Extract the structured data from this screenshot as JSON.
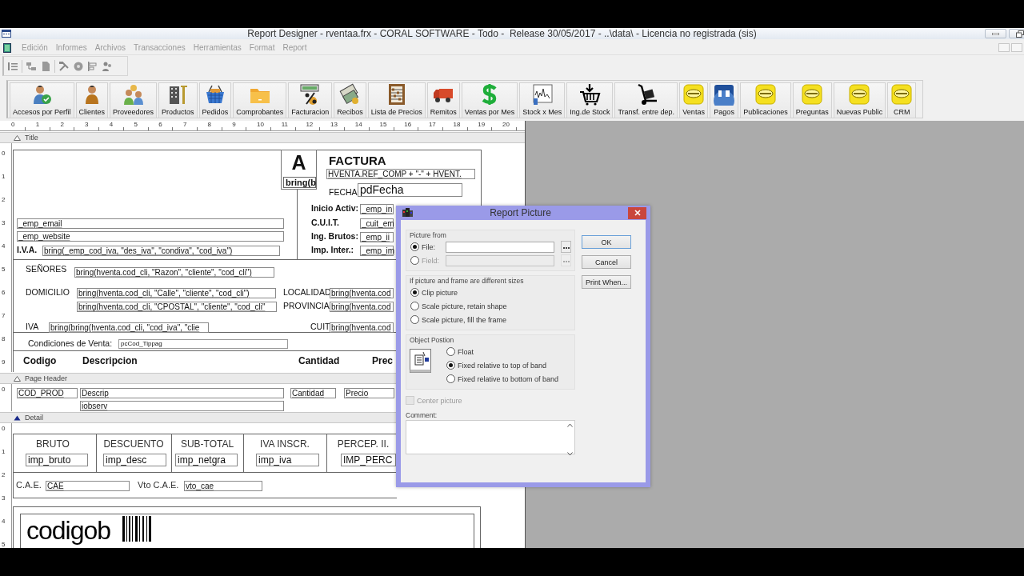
{
  "window": {
    "title": "Report Designer - rventaa.frx - CORAL SOFTWARE - Todo -  Release 30/05/2017 - ..\\data\\ - Licencia no registrada (sis)"
  },
  "menu": [
    {
      "label": "Edición",
      "disabled": true
    },
    {
      "label": "Informes",
      "disabled": true
    },
    {
      "label": "Archivos",
      "disabled": true
    },
    {
      "label": "Transacciones",
      "disabled": true
    },
    {
      "label": "Herramientas",
      "disabled": true
    },
    {
      "label": "Format",
      "disabled": true
    },
    {
      "label": "Report",
      "disabled": true
    }
  ],
  "toolbar": [
    {
      "label": "Accesos por Perfil"
    },
    {
      "label": "Clientes"
    },
    {
      "label": "Proveedores"
    },
    {
      "label": "Productos"
    },
    {
      "label": "Pedidos"
    },
    {
      "label": "Comprobantes"
    },
    {
      "label": "Facturacion"
    },
    {
      "label": "Recibos"
    },
    {
      "label": "Lista de Precios"
    },
    {
      "label": "Remitos"
    },
    {
      "label": "Ventas por Mes"
    },
    {
      "label": "Stock x Mes"
    },
    {
      "label": "Ing.de Stock"
    },
    {
      "label": "Transf. entre dep."
    },
    {
      "label": "Ventas"
    },
    {
      "label": "Pagos"
    },
    {
      "label": "Publicaciones"
    },
    {
      "label": "Preguntas"
    },
    {
      "label": "Nuevas Public"
    },
    {
      "label": "CRM"
    }
  ],
  "ruler": [
    "0",
    "1",
    "2",
    "3",
    "4",
    "5",
    "6",
    "7",
    "8",
    "9",
    "10",
    "11",
    "12",
    "13",
    "14",
    "15",
    "16",
    "17",
    "18",
    "19",
    "20"
  ],
  "bands": [
    {
      "label": "Title",
      "selected": false,
      "ruler": [
        "0",
        "1",
        "2",
        "3",
        "4",
        "5",
        "6",
        "7",
        "8",
        "9"
      ],
      "items": [
        {
          "kind": "letter",
          "text": "A"
        },
        {
          "kind": "bold-field",
          "text": "bring(b"
        },
        {
          "kind": "heading",
          "text": "FACTURA"
        },
        {
          "kind": "field",
          "text": "HVENTA.REF_COMP + \"-\"  + HVENT."
        },
        {
          "kind": "label",
          "text": "FECHA"
        },
        {
          "kind": "large-field",
          "text": "pdFecha"
        },
        {
          "kind": "bold-label",
          "text": "Inicio Activ:"
        },
        {
          "kind": "bold-label",
          "text": "C.U.I.T."
        },
        {
          "kind": "bold-label",
          "text": "Ing. Brutos:"
        },
        {
          "kind": "bold-label",
          "text": "Imp. Inter.:"
        },
        {
          "kind": "field",
          "text": "_emp_in"
        },
        {
          "kind": "field",
          "text": "_cuit_em"
        },
        {
          "kind": "field",
          "text": "_emp_ii"
        },
        {
          "kind": "field",
          "text": "_emp_im"
        },
        {
          "kind": "field",
          "text": "_emp_email"
        },
        {
          "kind": "field",
          "text": "_emp_website"
        },
        {
          "kind": "bold-label",
          "text": "I.V.A."
        },
        {
          "kind": "field",
          "text": "bring(_emp_cod_iva, \"des_iva\", \"condiva\", \"cod_iva\")"
        },
        {
          "kind": "label",
          "text": "SEÑORES"
        },
        {
          "kind": "field",
          "text": "bring(hventa.cod_cli, \"Razon\", \"cliente\", \"cod_cli\")"
        },
        {
          "kind": "label",
          "text": "DOMICILIO"
        },
        {
          "kind": "field",
          "text": "bring(hventa.cod_cli, \"Calle\", \"cliente\", \"cod_cli\")"
        },
        {
          "kind": "field",
          "text": "bring(hventa.cod_cli, \"CPOSTAL\", \"cliente\", \"cod_cli\""
        },
        {
          "kind": "label",
          "text": "LOCALIDAD"
        },
        {
          "kind": "label",
          "text": "PROVINCIA"
        },
        {
          "kind": "field",
          "text": "bring(hventa.cod"
        },
        {
          "kind": "field",
          "text": "bring(hventa.cod"
        },
        {
          "kind": "label",
          "text": "IVA"
        },
        {
          "kind": "field",
          "text": "bring(bring(hventa.cod_cli, \"cod_iva\", \"clie"
        },
        {
          "kind": "label",
          "text": "CUIT"
        },
        {
          "kind": "field",
          "text": "bring(hventa.cod"
        },
        {
          "kind": "label",
          "text": "Condiciones de Venta:"
        },
        {
          "kind": "small-field",
          "text": "pcCod_Tippag"
        },
        {
          "kind": "column-label",
          "text": "Codigo"
        },
        {
          "kind": "column-label",
          "text": "Descripcion"
        },
        {
          "kind": "column-label",
          "text": "Cantidad"
        },
        {
          "kind": "column-label",
          "text": "Prec"
        }
      ]
    },
    {
      "label": "Page Header",
      "selected": false,
      "ruler": [
        "0"
      ],
      "items": [
        {
          "kind": "field",
          "text": "COD_PROD"
        },
        {
          "kind": "field",
          "text": "Descrip"
        },
        {
          "kind": "field",
          "text": "Cantidad"
        },
        {
          "kind": "field",
          "text": "Precio"
        },
        {
          "kind": "field",
          "text": "iobserv"
        }
      ]
    },
    {
      "label": "Detail",
      "selected": true,
      "ruler": [
        "0",
        "1",
        "2",
        "3",
        "4",
        "5"
      ],
      "items": [
        {
          "kind": "caption",
          "text": "BRUTO"
        },
        {
          "kind": "caption",
          "text": "DESCUENTO"
        },
        {
          "kind": "caption",
          "text": "SUB-TOTAL"
        },
        {
          "kind": "caption",
          "text": "IVA INSCR."
        },
        {
          "kind": "caption",
          "text": "PERCEP. II."
        },
        {
          "kind": "total-field",
          "text": "imp_bruto"
        },
        {
          "kind": "total-field",
          "text": "imp_desc"
        },
        {
          "kind": "total-field",
          "text": "imp_netgra"
        },
        {
          "kind": "total-field",
          "text": "imp_iva"
        },
        {
          "kind": "total-field",
          "text": "IMP_PERC"
        },
        {
          "kind": "plain-label",
          "text": "C.A.E."
        },
        {
          "kind": "field",
          "text": "CAE"
        },
        {
          "kind": "plain-label",
          "text": "Vto C.A.E."
        },
        {
          "kind": "field",
          "text": "vto_cae"
        },
        {
          "kind": "barcode",
          "text": "codigob"
        }
      ]
    }
  ],
  "dialog": {
    "title": "Report Picture",
    "picture_from": {
      "label": "Picture from",
      "options": [
        {
          "label": "File:",
          "selected": true,
          "disabled": false
        },
        {
          "label": "Field:",
          "selected": false,
          "disabled": true
        }
      ]
    },
    "sizing": {
      "label": "If picture and frame are different sizes",
      "options": [
        {
          "label": "Clip picture",
          "selected": true
        },
        {
          "label": "Scale picture, retain shape",
          "selected": false
        },
        {
          "label": "Scale picture, fill the frame",
          "selected": false
        }
      ]
    },
    "position": {
      "label": "Object Postion",
      "options": [
        {
          "label": "Float",
          "selected": false
        },
        {
          "label": "Fixed relative to top of band",
          "selected": true
        },
        {
          "label": "Fixed relative to bottom of band",
          "selected": false
        }
      ]
    },
    "center": {
      "label": "Center picture",
      "checked": false,
      "disabled": true
    },
    "comment": {
      "label": "Comment:"
    },
    "buttons": [
      {
        "label": "OK",
        "default": true
      },
      {
        "label": "Cancel",
        "default": false
      },
      {
        "label": "Print When...",
        "default": false
      }
    ]
  }
}
